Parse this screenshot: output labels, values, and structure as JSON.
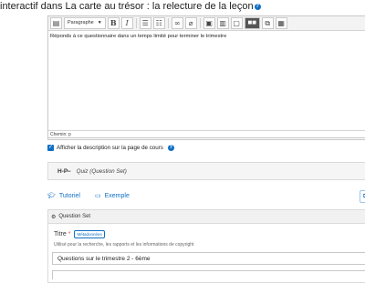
{
  "page": {
    "title": "interactif dans La carte au trésor : la relecture de la leçon",
    "title_help_icon": "question-circle-icon"
  },
  "editor": {
    "format_select": "Paragraphe",
    "bold_label": "B",
    "italic_label": "I",
    "content": "Réponds à ce questionnaire dans un temps limité pour terminer le trimestre",
    "path": "Chemin: p"
  },
  "options": {
    "show_description_label": "Afficher la description sur la page de cours",
    "checked": true
  },
  "h5p": {
    "logo": "H-P",
    "logo_suffix": "ᵗᵉʳ",
    "content_type": "Quiz (Question Set)"
  },
  "links": {
    "tutorial": "Tutoriel",
    "example": "Exemple",
    "copy_label": "C"
  },
  "question_set": {
    "header": "Question Set",
    "title_label": "Titre",
    "metadata_badge": "Métadonnées",
    "title_desc": "Utilisé pour la recherche, les rapports et les informations de copyright",
    "title_value": "Questions sur le trimestre 2 - 6ème"
  },
  "colors": {
    "accent": "#0f6fc5",
    "required": "#d9534f"
  }
}
